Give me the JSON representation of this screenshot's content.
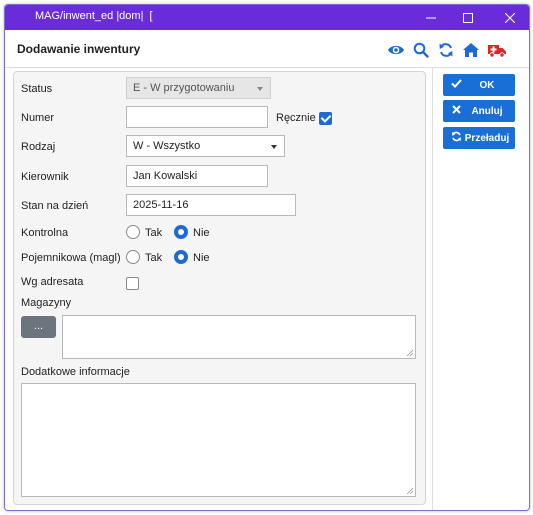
{
  "window": {
    "title": "MAG/inwent_ed |dom|  [",
    "controls": [
      "minimize-icon",
      "maximize-icon",
      "close-icon"
    ]
  },
  "header": {
    "title": "Dodawanie inwentury",
    "icons": [
      "eye-icon",
      "search-icon",
      "refresh-icon",
      "home-icon",
      "ambulance-icon"
    ]
  },
  "form": {
    "status": {
      "label": "Status",
      "value": "E - W przygotowaniu"
    },
    "numer": {
      "label": "Numer",
      "value": "",
      "manual_label": "Ręcznie",
      "manual_checked": true
    },
    "rodzaj": {
      "label": "Rodzaj",
      "value": "W - Wszystko"
    },
    "kierownik": {
      "label": "Kierownik",
      "value": "Jan Kowalski"
    },
    "stan_na_dzien": {
      "label": "Stan na dzień",
      "value": "2025-11-16"
    },
    "kontrolna": {
      "label": "Kontrolna",
      "options": [
        "Tak",
        "Nie"
      ],
      "selected": "Nie"
    },
    "pojemnikowa": {
      "label": "Pojemnikowa (magl)",
      "options": [
        "Tak",
        "Nie"
      ],
      "selected": "Nie"
    },
    "wg_adresata": {
      "label": "Wg adresata",
      "checked": false
    },
    "magazyny": {
      "label": "Magazyny",
      "button_label": "...",
      "value": ""
    },
    "dodatkowe": {
      "label": "Dodatkowe informacje",
      "value": ""
    }
  },
  "actions": {
    "ok": "OK",
    "anuluj": "Anuluj",
    "przeladuj": "Przeładuj"
  },
  "colors": {
    "titlebar": "#6a2bd8",
    "accent": "#1a6fd6",
    "ambulance": "#e02424",
    "icon_blue": "#1e6ad1"
  }
}
